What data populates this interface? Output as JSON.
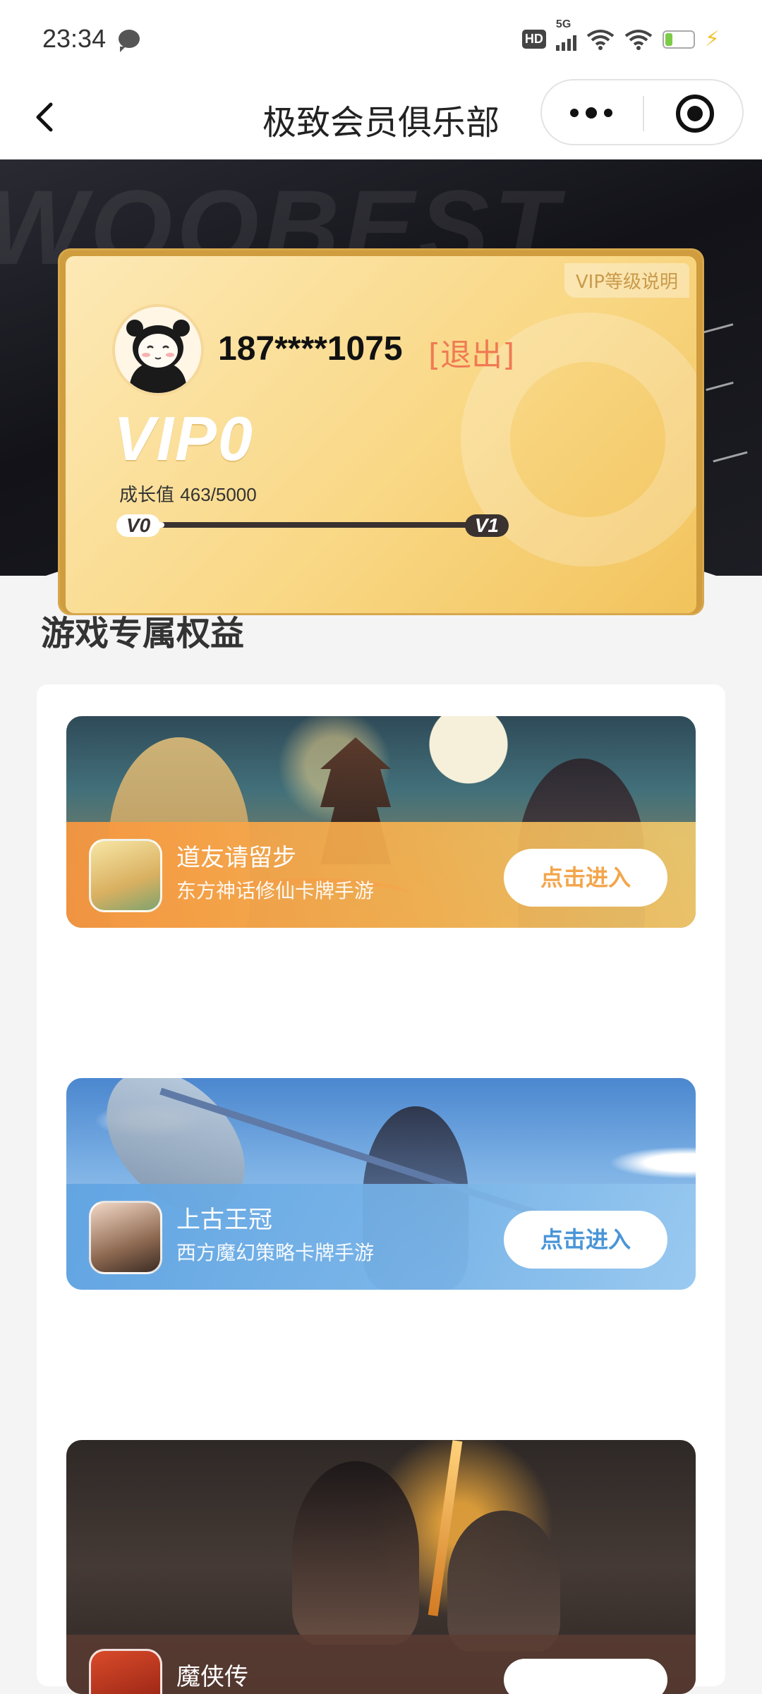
{
  "status_bar": {
    "time": "23:34",
    "network_badge": "HD",
    "network_type": "5G",
    "battery_level": "15",
    "icons": [
      "message-icon",
      "hd-icon",
      "signal-icon",
      "wifi-icon",
      "battery-icon",
      "charging-icon"
    ]
  },
  "navbar": {
    "title": "极致会员俱乐部",
    "back_icon": "chevron-left-icon",
    "more_icon": "more-dots-icon",
    "close_icon": "target-circle-icon"
  },
  "member_card": {
    "background_watermark": "WOOBEST",
    "vip_explain_label": "VIP等级说明",
    "phone": "187****1075",
    "logout_label": "[退出]",
    "vip_level_label": "VIP0",
    "growth_label": "成长值",
    "growth_value": "463/5000",
    "growth_progress_fraction": 0.0926,
    "current_level": "V0",
    "next_level": "V1"
  },
  "section": {
    "title": "游戏专属权益"
  },
  "games": [
    {
      "name": "道友请留步",
      "description": "东方神话修仙卡牌手游",
      "enter_label": "点击进入",
      "accent": "#f3a54b"
    },
    {
      "name": "上古王冠",
      "description": "西方魔幻策略卡牌手游",
      "enter_label": "点击进入",
      "accent": "#4a95d8"
    },
    {
      "name": "魔侠传",
      "description": "",
      "enter_label": "",
      "accent": "#d94b2a"
    }
  ]
}
